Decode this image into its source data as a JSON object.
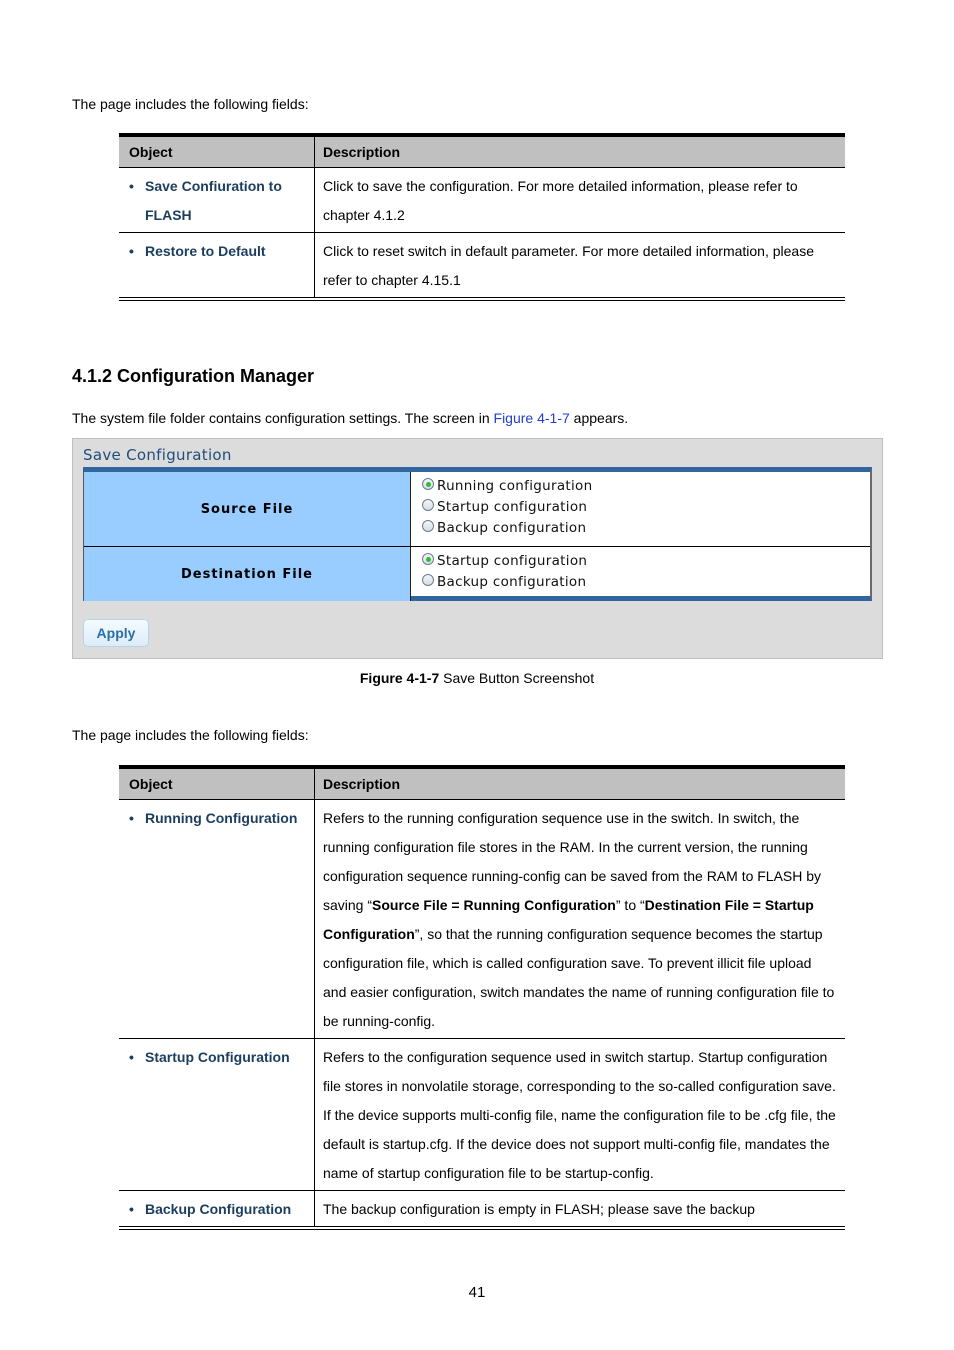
{
  "intro1": "The page includes the following fields:",
  "table1": {
    "headers": [
      "Object",
      "Description"
    ],
    "rows": [
      {
        "object": "Save Confiuration to FLASH",
        "description": "Click to save the configuration. For more detailed information, please refer to chapter 4.1.2"
      },
      {
        "object": "Restore to Default",
        "description": "Click to reset switch in default parameter. For more detailed information, please refer to chapter 4.15.1"
      }
    ]
  },
  "section": {
    "heading": "4.1.2 Configuration Manager",
    "intro_before": "The system file folder contains configuration settings. The screen in ",
    "intro_link": "Figure 4-1-7",
    "intro_after": " appears."
  },
  "screenshot": {
    "title": "Save Configuration",
    "source": {
      "label": "Source File",
      "options": [
        {
          "label": "Running configuration",
          "selected": true
        },
        {
          "label": "Startup configuration",
          "selected": false
        },
        {
          "label": "Backup configuration",
          "selected": false
        }
      ]
    },
    "destination": {
      "label": "Destination File",
      "options": [
        {
          "label": "Startup configuration",
          "selected": true
        },
        {
          "label": "Backup configuration",
          "selected": false
        }
      ]
    },
    "apply_label": "Apply"
  },
  "caption": {
    "bold": "Figure 4-1-7",
    "text": " Save Button Screenshot"
  },
  "intro2": "The page includes the following fields:",
  "table2": {
    "headers": [
      "Object",
      "Description"
    ],
    "rows": [
      {
        "object": "Running Configuration",
        "description_parts": [
          {
            "t": "Refers to the running configuration sequence use in the switch. In switch, the running configuration file stores in the RAM. In the current version, the running configuration sequence running-config can be saved from the RAM to FLASH by saving “",
            "b": false
          },
          {
            "t": "Source File = Running Configuration",
            "b": true
          },
          {
            "t": "” to “",
            "b": false
          },
          {
            "t": "Destination File = Startup Configuration",
            "b": true
          },
          {
            "t": "”, so that the running configuration sequence becomes the startup configuration file, which is called configuration save. To prevent illicit file upload and easier configuration, switch mandates the name of running configuration file to be running-config.",
            "b": false
          }
        ]
      },
      {
        "object": "Startup Configuration",
        "description_parts": [
          {
            "t": "Refers to the configuration sequence used in switch startup. Startup configuration file stores in nonvolatile storage, corresponding to the so-called configuration save. If the device supports multi-config file, name the configuration file to be .cfg file, the default is startup.cfg. If the device does not support multi-config file, mandates the name of startup configuration file to be startup-config.",
            "b": false
          }
        ]
      },
      {
        "object": "Backup Configuration",
        "description_parts": [
          {
            "t": "The backup configuration is empty in FLASH; please save the backup",
            "b": false
          }
        ]
      }
    ]
  },
  "page_number": "41"
}
